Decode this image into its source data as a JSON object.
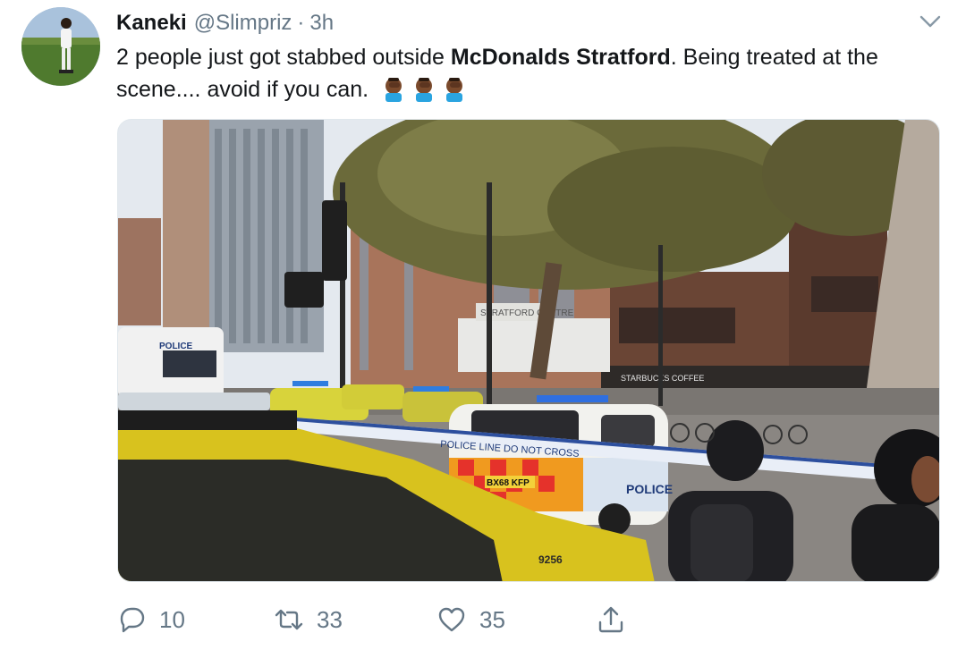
{
  "tweet": {
    "author_name": "Kaneki",
    "handle": "@Slimpriz",
    "separator": "·",
    "time": "3h",
    "text_before": "2 people just got stabbed outside ",
    "text_bold": "McDonalds Stratford",
    "text_after": ". Being treated at the scene.... avoid if you can.",
    "emoji_icons": [
      "facepalm-emoji",
      "facepalm-emoji",
      "facepalm-emoji"
    ]
  },
  "media": {
    "kind": "photo",
    "signs": {
      "police_van": "POLICE",
      "tape": "POLICE LINE DO NOT CROSS",
      "centre": "STRATFORD CENTRE",
      "coffee": "STARBUCKS COFFEE",
      "plate": "BX68 KFP",
      "car_side": "POLICE",
      "taxi_number": "9256"
    }
  },
  "actions": {
    "reply_count": "10",
    "retweet_count": "33",
    "like_count": "35",
    "icons": [
      "reply-icon",
      "retweet-icon",
      "like-icon",
      "share-icon"
    ]
  },
  "colors": {
    "text_primary": "#14171a",
    "text_secondary": "#657786",
    "border": "#e1e8ed"
  }
}
